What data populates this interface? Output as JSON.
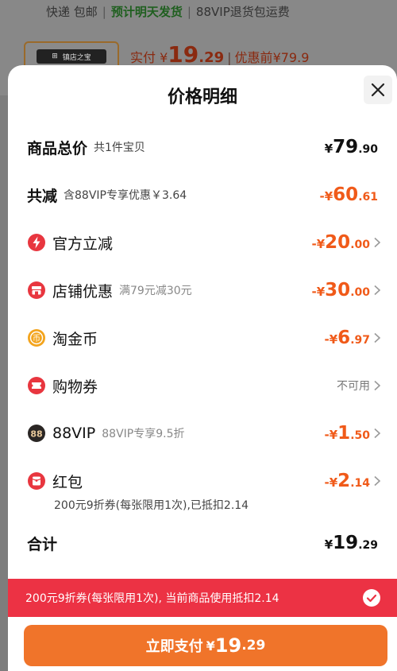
{
  "background": {
    "shipping": [
      "快递 包邮",
      "预计明天发货",
      "88VIP退货包运费"
    ],
    "store_badge": "镇店之宝",
    "paid_label": "实付",
    "paid_currency": "¥",
    "paid_int": "19",
    "paid_dec": ".29",
    "before_label": "优惠前",
    "before_amount": "¥79.9"
  },
  "sheet": {
    "title": "价格明细",
    "rows": [
      {
        "label": "商品总价",
        "sub": "共1件宝贝",
        "cur": "¥",
        "int": "79",
        "dec": ".90"
      },
      {
        "label": "共减",
        "sub": "含88VIP专享优惠￥3.64",
        "cur": "-¥",
        "int": "60",
        "dec": ".61"
      },
      {
        "label": "官方立减",
        "sub": "",
        "cur": "-¥",
        "int": "20",
        "dec": ".00"
      },
      {
        "label": "店铺优惠",
        "sub": "满79元减30元",
        "cur": "-¥",
        "int": "30",
        "dec": ".00"
      },
      {
        "label": "淘金币",
        "sub": "",
        "cur": "-¥",
        "int": "6",
        "dec": ".97"
      },
      {
        "label": "购物券",
        "sub": "",
        "status": "不可用"
      },
      {
        "label": "88VIP",
        "sub": "88VIP专享9.5折",
        "cur": "-¥",
        "int": "1",
        "dec": ".50"
      },
      {
        "label": "红包",
        "sub": "",
        "cur": "-¥",
        "int": "2",
        "dec": ".14"
      },
      {
        "label": "合计",
        "sub": "",
        "cur": "¥",
        "int": "19",
        "dec": ".29"
      }
    ],
    "redpacket_note": "200元9折券(每张限用1次),已抵扣2.14",
    "vip_badge": "88",
    "coupon_bar": "200元9折券(每张限用1次), 当前商品使用抵扣2.14",
    "pay": {
      "label": "立即支付",
      "cur": "¥",
      "int": "19",
      "dec": ".29"
    }
  },
  "colors": {
    "accent": "#f05a19",
    "coupon_bar": "#ec3244",
    "pay_button": "#f0742a",
    "icon_red": "#e8363f",
    "coin_yellow": "#f3a41d"
  },
  "icons": [
    "close-icon",
    "lightning-icon",
    "shop-icon",
    "coin-icon",
    "voucher-icon",
    "vip-icon",
    "red-packet-icon",
    "chevron-right-icon",
    "check-icon"
  ]
}
